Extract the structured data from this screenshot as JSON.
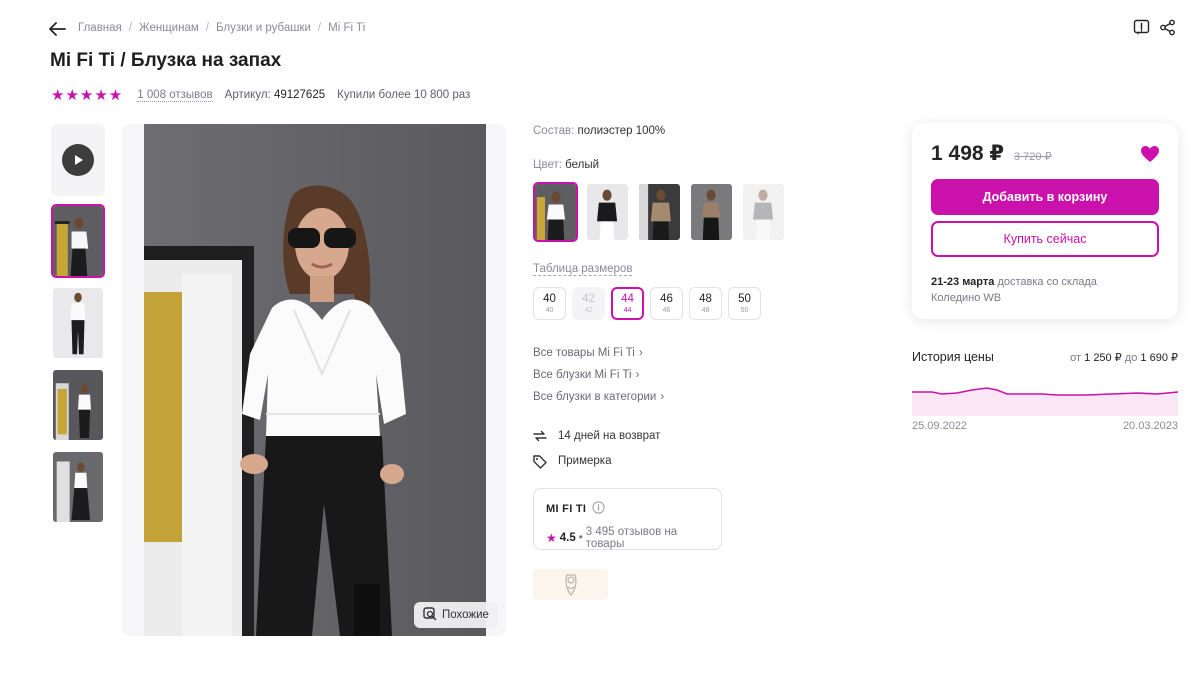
{
  "breadcrumbs": [
    "Главная",
    "Женщинам",
    "Блузки и рубашки",
    "Mi Fi Ti"
  ],
  "product": {
    "title": "Mi Fi Ti / Блузка на запах",
    "rating_stars": 5,
    "reviews_label": "1 008 отзывов",
    "article_label": "Артикул:",
    "article_value": "49127625",
    "bought_label": "Купили более 10 800 раз"
  },
  "gallery": {
    "similar_label": "Похожие",
    "thumbnail_count": 4
  },
  "details": {
    "composition_label": "Состав:",
    "composition_value": "полиэстер 100%",
    "color_label": "Цвет:",
    "color_value": "белый",
    "color_options": 5,
    "size_table_label": "Таблица размеров",
    "sizes": [
      {
        "label": "40",
        "ru": "40",
        "state": "available"
      },
      {
        "label": "42",
        "ru": "42",
        "state": "disabled"
      },
      {
        "label": "44",
        "ru": "44",
        "state": "selected"
      },
      {
        "label": "46",
        "ru": "46",
        "state": "available"
      },
      {
        "label": "48",
        "ru": "48",
        "state": "available"
      },
      {
        "label": "50",
        "ru": "50",
        "state": "available"
      }
    ],
    "links": [
      "Все товары Mi Fi Ti",
      "Все блузки Mi Fi Ti",
      "Все блузки в категории"
    ],
    "return_label": "14 дней на возврат",
    "fitting_label": "Примерка"
  },
  "seller": {
    "name": "MI FI TI",
    "rating": "4.5",
    "reviews": "3 495 отзывов на товары"
  },
  "buy": {
    "price": "1 498 ₽",
    "old_price": "3 720 ₽",
    "add_to_cart": "Добавить в корзину",
    "buy_now": "Купить сейчас",
    "delivery_date": "21-23 марта",
    "delivery_text": "доставка со склада",
    "warehouse": "Коледино WB"
  },
  "price_history": {
    "title": "История цены",
    "range_from_label": "от",
    "range_from": "1 250 ₽",
    "range_to_label": "до",
    "range_to": "1 690 ₽",
    "date_start": "25.09.2022",
    "date_end": "20.03.2023"
  },
  "colors": {
    "accent": "#cb11ab",
    "text": "#242424",
    "muted": "#8b8b99"
  }
}
